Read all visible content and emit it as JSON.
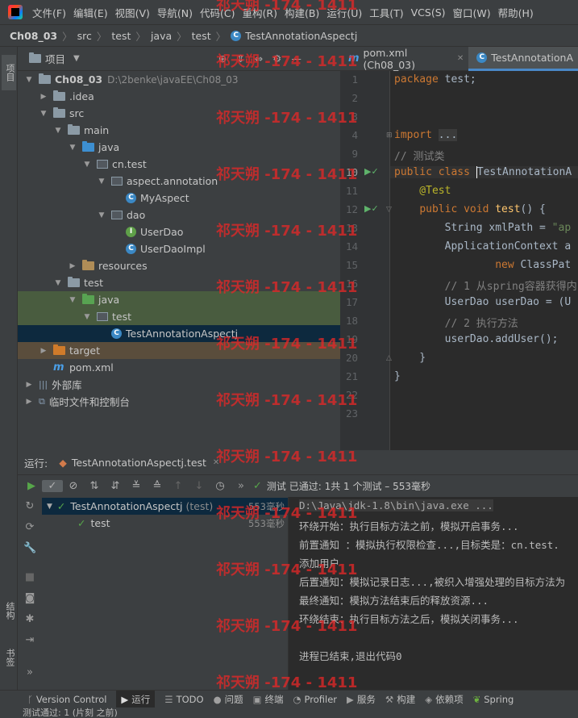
{
  "menu": [
    "文件(F)",
    "编辑(E)",
    "视图(V)",
    "导航(N)",
    "代码(C)",
    "重构(R)",
    "构建(B)",
    "运行(U)",
    "工具(T)",
    "VCS(S)",
    "窗口(W)",
    "帮助(H)"
  ],
  "breadcrumb": [
    "Ch08_03",
    "src",
    "test",
    "java",
    "test",
    "TestAnnotationAspectj"
  ],
  "left_tabs": {
    "project": "项目",
    "structure": "结构",
    "bookmarks": "书签"
  },
  "project": {
    "title": "项目",
    "rows": [
      {
        "label": "Ch08_03",
        "extra": "D:\\2benke\\javaEE\\Ch08_03"
      },
      {
        "label": ".idea"
      },
      {
        "label": "src"
      },
      {
        "label": "main"
      },
      {
        "label": "java"
      },
      {
        "label": "cn.test"
      },
      {
        "label": "aspect.annotation"
      },
      {
        "label": "MyAspect"
      },
      {
        "label": "dao"
      },
      {
        "label": "UserDao"
      },
      {
        "label": "UserDaoImpl"
      },
      {
        "label": "resources"
      },
      {
        "label": "test"
      },
      {
        "label": "java"
      },
      {
        "label": "test"
      },
      {
        "label": "TestAnnotationAspectj"
      },
      {
        "label": "target"
      },
      {
        "label": "pom.xml"
      },
      {
        "label": "外部库"
      },
      {
        "label": "临时文件和控制台"
      }
    ]
  },
  "editor": {
    "tabs": [
      {
        "label": "pom.xml (Ch08_03)"
      },
      {
        "label": "TestAnnotationA"
      }
    ],
    "line_numbers": [
      "1",
      "2",
      "3",
      "4",
      "9",
      "10",
      "11",
      "12",
      "13",
      "14",
      "15",
      "16",
      "17",
      "18",
      "19",
      "20",
      "21",
      "22",
      "23"
    ],
    "code": [
      "package test;",
      "",
      "",
      "import ...",
      "// 测试类",
      "public class TestAnnotationA",
      "    @Test",
      "    public void test() {",
      "        String xmlPath = \"ap",
      "        ApplicationContext a",
      "                new ClassPat",
      "        // 1 从spring容器获得内",
      "        UserDao userDao = (U",
      "        // 2 执行方法",
      "        userDao.addUser();",
      "    }",
      "}",
      "",
      ""
    ]
  },
  "run": {
    "label": "运行:",
    "tab": "TestAnnotationAspectj.test",
    "status": "测试 已通过: 1共 1 个测试 – 553毫秒",
    "tree": [
      {
        "label": "TestAnnotationAspectj",
        "sub": "(test)",
        "time": "553毫秒"
      },
      {
        "label": "test",
        "time": "553毫秒"
      }
    ],
    "console": [
      "D:\\Java\\jdk-1.8\\bin\\java.exe ...",
      "环绕开始：执行目标方法之前，模拟开启事务...",
      "前置通知 ：模拟执行权限检查...,目标类是：cn.test.",
      "添加用户",
      "后置通知：模拟记录日志...,被织入增强处理的目标方法为",
      "最终通知：模拟方法结束后的释放资源...",
      "环绕结束：执行目标方法之后，模拟关闭事务...",
      "",
      "进程已结束,退出代码0"
    ]
  },
  "bottom_tabs": [
    "Version Control",
    "运行",
    "TODO",
    "问题",
    "终端",
    "Profiler",
    "服务",
    "构建",
    "依赖项",
    "Spring"
  ],
  "status_text": "测试通过: 1 (片刻 之前)",
  "watermark": "祁天朔 -174 - 1411"
}
